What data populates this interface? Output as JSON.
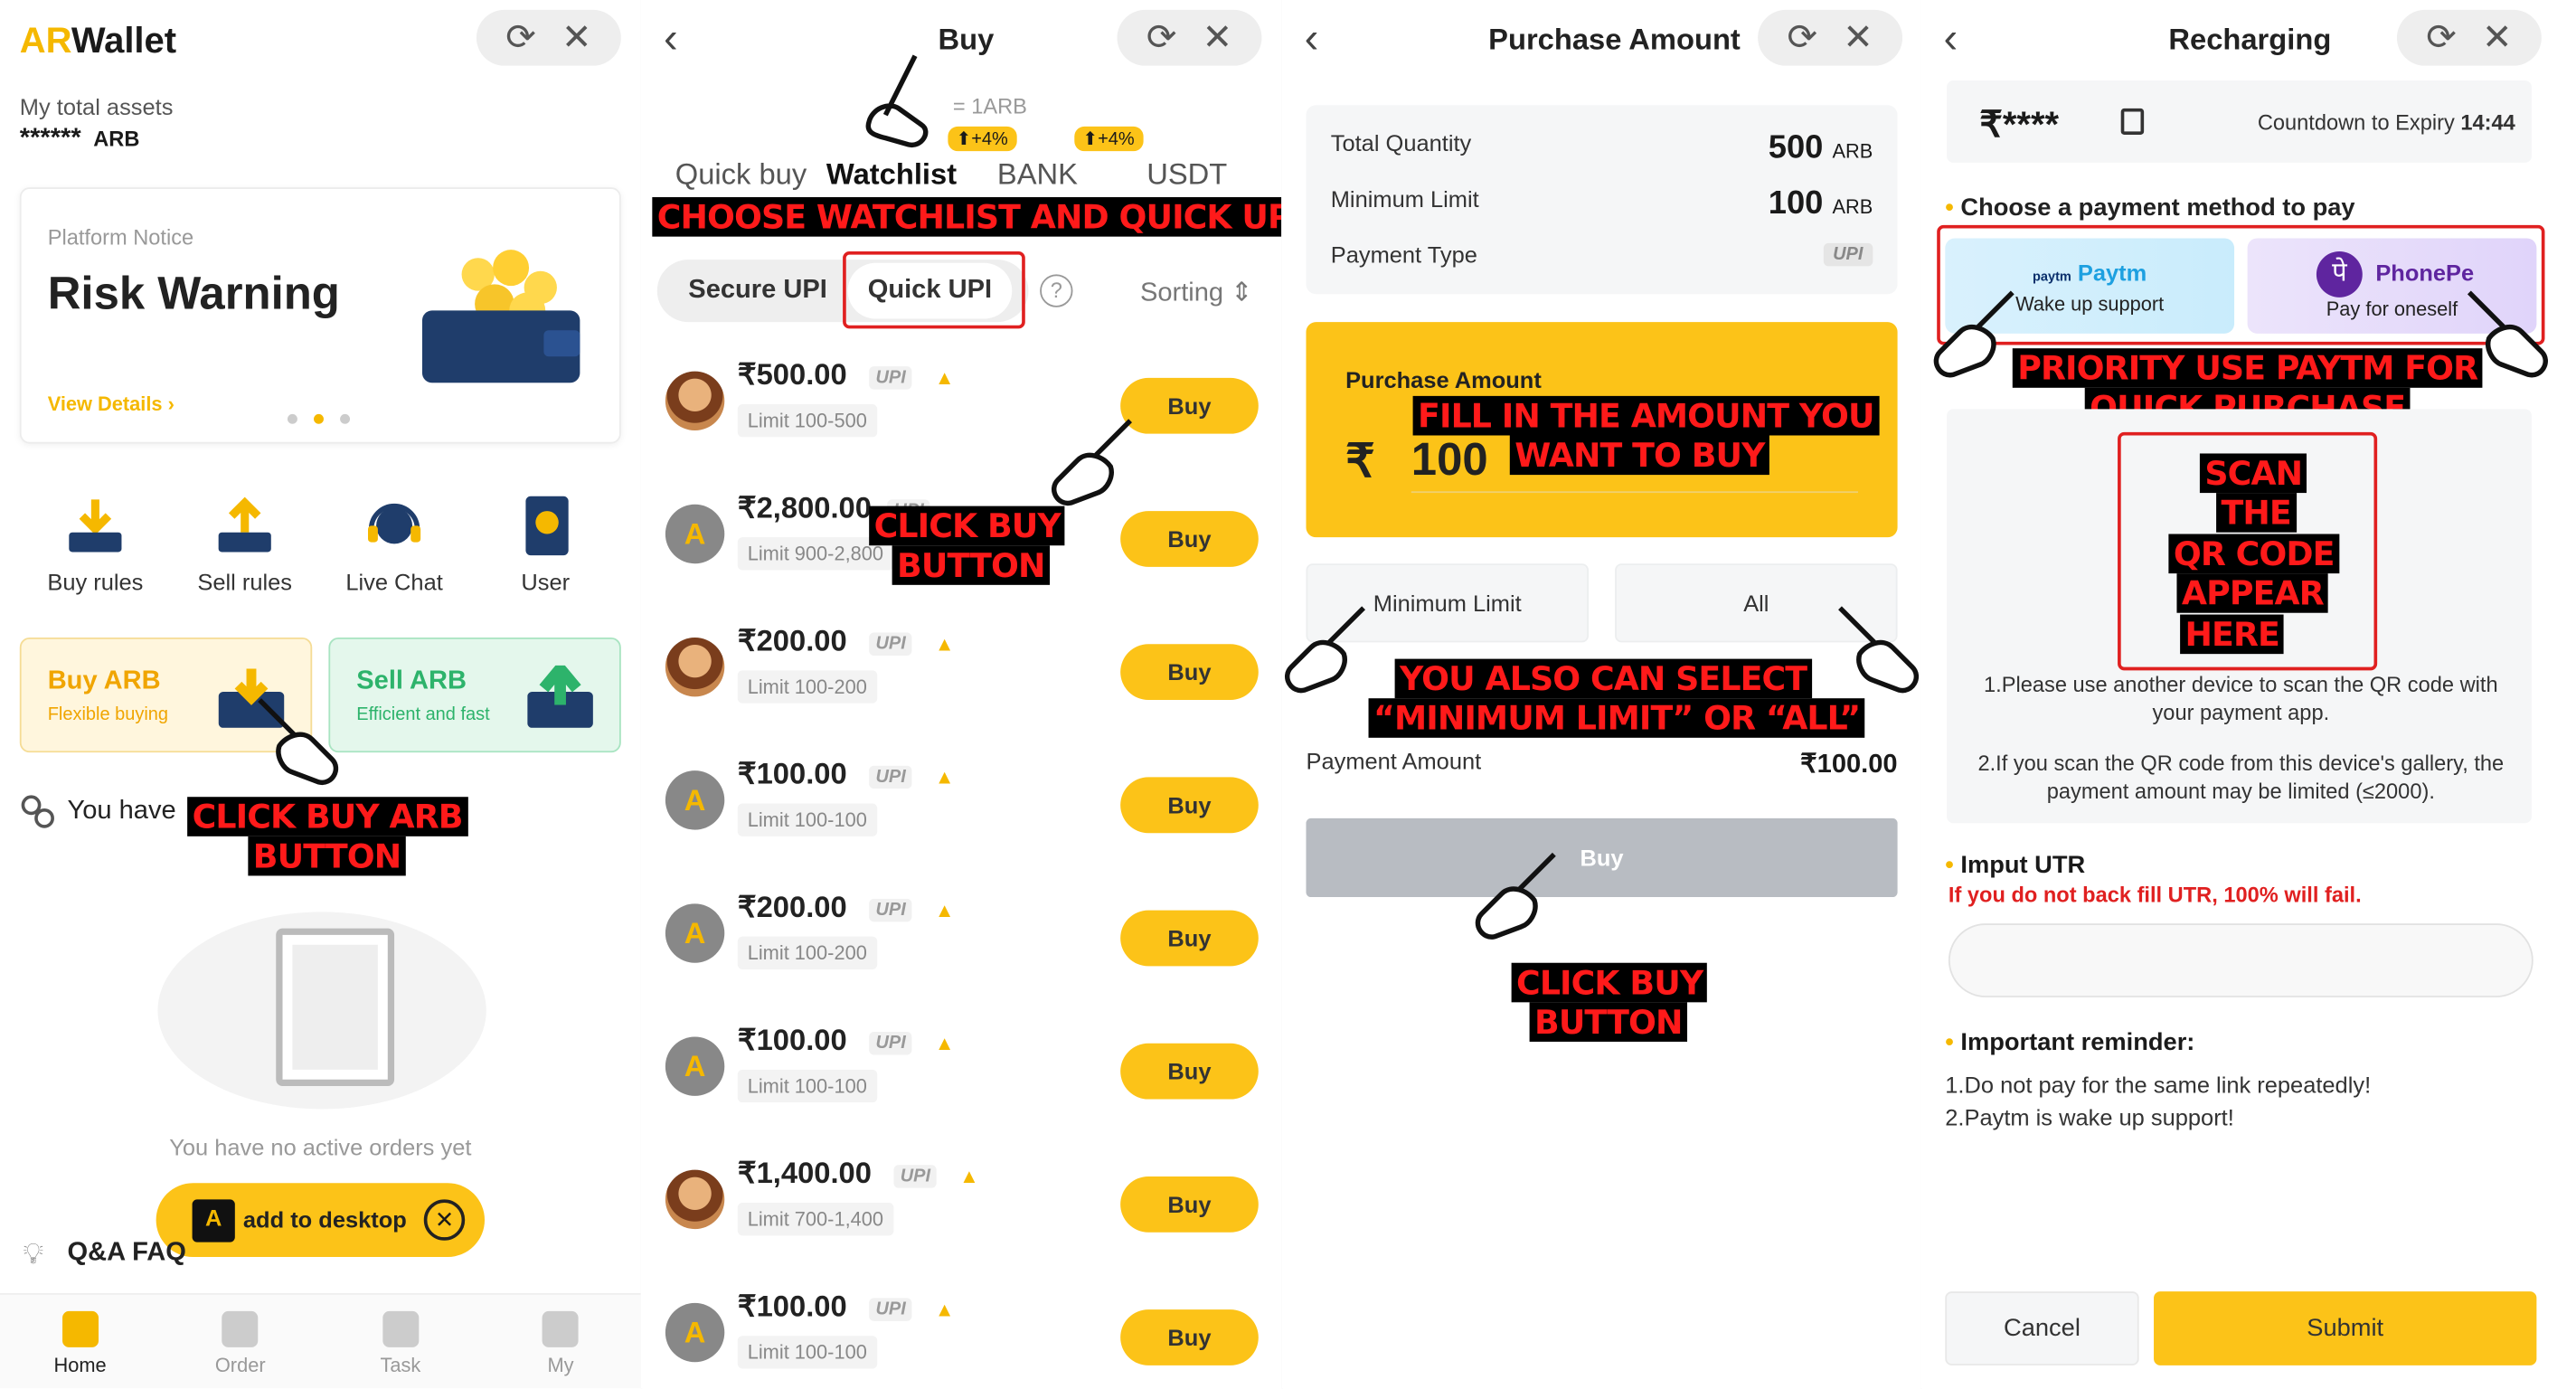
{
  "screen1": {
    "logo_ar": "AR",
    "logo_wallet": "Wallet",
    "total_assets_label": "My total assets",
    "assets_value": "******",
    "assets_unit": "ARB",
    "notice_label": "Platform Notice",
    "notice_title": "Risk Warning",
    "view_details": "View Details",
    "quick_links": [
      "Buy rules",
      "Sell rules",
      "Live Chat",
      "User"
    ],
    "buy_card_title": "Buy ARB",
    "buy_card_sub": "Flexible buying",
    "sell_card_title": "Sell ARB",
    "sell_card_sub": "Efficient and fast",
    "orders_label": "You have",
    "empty_text": "You have no active orders yet",
    "add_desktop": "add to desktop",
    "app_badge": "AR Wallet",
    "faq": "Q&A FAQ",
    "tabs": [
      "Home",
      "Order",
      "Task",
      "My"
    ],
    "annotation": [
      "CLICK BUY ARB",
      "BUTTON"
    ]
  },
  "screen2": {
    "title": "Buy",
    "rate": "= 1ARB",
    "badge1": "+4%",
    "badge2": "+4%",
    "tabs": [
      "Quick buy",
      "Watchlist",
      "BANK",
      "USDT"
    ],
    "annotation_top": "CHOOSE WATCHLIST AND QUICK UPI",
    "filters": [
      "Secure UPI",
      "Quick UPI"
    ],
    "help": "?",
    "sorting": "Sorting",
    "upi_tag": "UPI",
    "buy_label": "Buy",
    "orders": [
      {
        "price": "₹500.00",
        "limit": "Limit 100-500",
        "avatar": "person"
      },
      {
        "price": "₹2,800.00",
        "limit": "Limit 900-2,800",
        "avatar": "logo"
      },
      {
        "price": "₹200.00",
        "limit": "Limit 100-200",
        "avatar": "person"
      },
      {
        "price": "₹100.00",
        "limit": "Limit 100-100",
        "avatar": "logo"
      },
      {
        "price": "₹200.00",
        "limit": "Limit 100-200",
        "avatar": "logo"
      },
      {
        "price": "₹100.00",
        "limit": "Limit 100-100",
        "avatar": "logo"
      },
      {
        "price": "₹1,400.00",
        "limit": "Limit 700-1,400",
        "avatar": "person"
      },
      {
        "price": "₹100.00",
        "limit": "Limit 100-100",
        "avatar": "logo"
      }
    ],
    "annotation_buy": [
      "CLICK BUY",
      "BUTTON"
    ]
  },
  "screen3": {
    "title": "Purchase Amount",
    "total_qty_label": "Total Quantity",
    "total_qty_value": "500",
    "min_limit_label": "Minimum Limit",
    "min_limit_value": "100",
    "unit": "ARB",
    "payment_type_label": "Payment Type",
    "payment_type_value": "UPI",
    "purchase_label": "Purchase Amount",
    "currency": "₹",
    "amount": "100",
    "annotation_amount": [
      "FILL IN THE AMOUNT YOU",
      "WANT TO BUY"
    ],
    "min_button": "Minimum Limit",
    "all_button": "All",
    "annotation_select": [
      "YOU ALSO CAN SELECT",
      "“MINIMUM LIMIT” OR “ALL”"
    ],
    "payment_amount_label": "Payment Amount",
    "payment_amount_value": "₹100.00",
    "buy_button": "Buy",
    "annotation_buy": [
      "CLICK BUY",
      "BUTTON"
    ]
  },
  "screen4": {
    "title": "Recharging",
    "masked_amount": "₹****",
    "countdown_label": "Countdown to Expiry",
    "countdown_value": "14:44",
    "choose_method": "Choose a payment method to pay",
    "paytm_logo": "paytm",
    "paytm_name": "Paytm",
    "paytm_sub": "Wake up support",
    "phonepe_name": "PhonePe",
    "phonepe_sub": "Pay for oneself",
    "annotation_priority": [
      "PRIORITY USE PAYTM FOR",
      "QUICK PURCHASE"
    ],
    "annotation_qr": [
      "SCAN",
      "THE",
      "QR CODE",
      "APPEAR",
      "HERE"
    ],
    "qr_note1": "1.Please use another device to scan the QR code with your payment app.",
    "qr_note2": "2.If you scan the QR code from this device's gallery, the payment amount may be limited (≤2000).",
    "utr_label": "Imput UTR",
    "utr_warning": "If you do not back fill UTR, 100% will fail.",
    "reminder_title": "Important reminder:",
    "reminder1": "1.Do not pay for the same link repeatedly!",
    "reminder2": "2.Paytm is wake up support!",
    "cancel": "Cancel",
    "submit": "Submit"
  },
  "colors": {
    "accent": "#fcc318",
    "annotation_red": "#ff1a1a",
    "green": "#2db36b",
    "warning_red": "#e02020"
  }
}
